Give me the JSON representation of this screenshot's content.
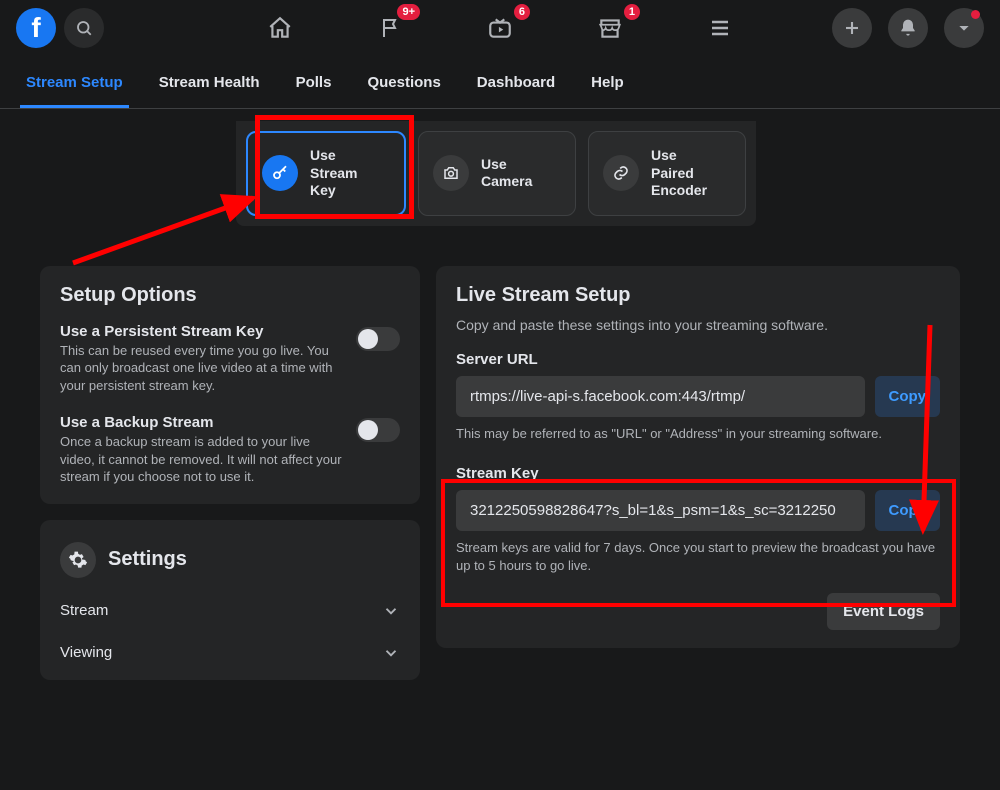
{
  "top": {
    "logo_letter": "f",
    "badges": {
      "flag": "9+",
      "video": "6",
      "market": "1"
    }
  },
  "subnav": {
    "tabs": [
      "Stream Setup",
      "Stream Health",
      "Polls",
      "Questions",
      "Dashboard",
      "Help"
    ],
    "active_index": 0
  },
  "methods": {
    "key": "Use Stream Key",
    "camera": "Use Camera",
    "paired": "Use Paired Encoder"
  },
  "setup_options": {
    "title": "Setup Options",
    "persistent": {
      "title": "Use a Persistent Stream Key",
      "desc": "This can be reused every time you go live. You can only broadcast one live video at a time with your persistent stream key."
    },
    "backup": {
      "title": "Use a Backup Stream",
      "desc": "Once a backup stream is added to your live video, it cannot be removed. It will not affect your stream if you choose not to use it."
    }
  },
  "settings": {
    "title": "Settings",
    "rows": [
      "Stream",
      "Viewing"
    ]
  },
  "live": {
    "title": "Live Stream Setup",
    "sub": "Copy and paste these settings into your streaming software.",
    "server_label": "Server URL",
    "server_value": "rtmps://live-api-s.facebook.com:443/rtmp/",
    "server_hint": "This may be referred to as \"URL\" or \"Address\" in your streaming software.",
    "key_label": "Stream Key",
    "key_value": "3212250598828647?s_bl=1&s_psm=1&s_sc=3212250",
    "key_hint": "Stream keys are valid for 7 days. Once you start to preview the broadcast you have up to 5 hours to go live.",
    "copy": "Copy",
    "event_logs": "Event Logs"
  }
}
